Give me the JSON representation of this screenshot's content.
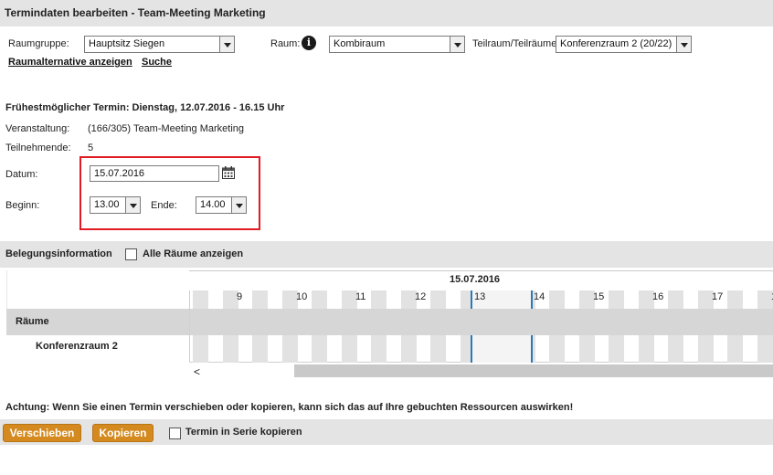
{
  "title": "Termindaten bearbeiten - Team-Meeting Marketing",
  "filters": {
    "raumgruppe_label": "Raumgruppe:",
    "raumgruppe_value": "Hauptsitz Siegen",
    "raum_label": "Raum:",
    "raum_value": "Kombiraum",
    "teilraum_label": "Teilraum/Teilräume",
    "teilraum_value": "Konferenzraum 2 (20/22)",
    "link_alternative": "Raumalternative anzeigen",
    "link_suche": "Suche"
  },
  "details": {
    "earliest": "Frühestmöglicher Termin: Dienstag, 12.07.2016 - 16.15 Uhr",
    "veranstaltung_label": "Veranstaltung:",
    "veranstaltung_value": "(166/305) Team-Meeting Marketing",
    "teilnehmende_label": "Teilnehmende:",
    "teilnehmende_value": "5",
    "datum_label": "Datum:",
    "datum_value": "15.07.2016",
    "beginn_label": "Beginn:",
    "beginn_value": "13.00",
    "ende_label": "Ende:",
    "ende_value": "14.00"
  },
  "belegung": {
    "title": "Belegungsinformation",
    "alle_raeume_label": "Alle Räume anzeigen"
  },
  "timeline": {
    "date": "15.07.2016",
    "hours": [
      "9",
      "10",
      "11",
      "12",
      "13",
      "14",
      "15",
      "16",
      "17",
      "1"
    ],
    "rooms_header": "Räume",
    "rooms": [
      "Konferenzraum 2"
    ],
    "scroll_left_glyph": "<",
    "selection_line_color": "#2a7ab8"
  },
  "warning": "Achtung: Wenn Sie einen Termin verschieben oder kopieren, kann sich das auf Ihre gebuchten Ressourcen auswirken!",
  "actions": {
    "verschieben": "Verschieben",
    "kopieren": "Kopieren",
    "serie_label": "Termin in Serie kopieren"
  },
  "colors": {
    "accent_button": "#d48a1e",
    "highlight_box": "#e01b24",
    "bar_background": "#e4e4e4"
  }
}
